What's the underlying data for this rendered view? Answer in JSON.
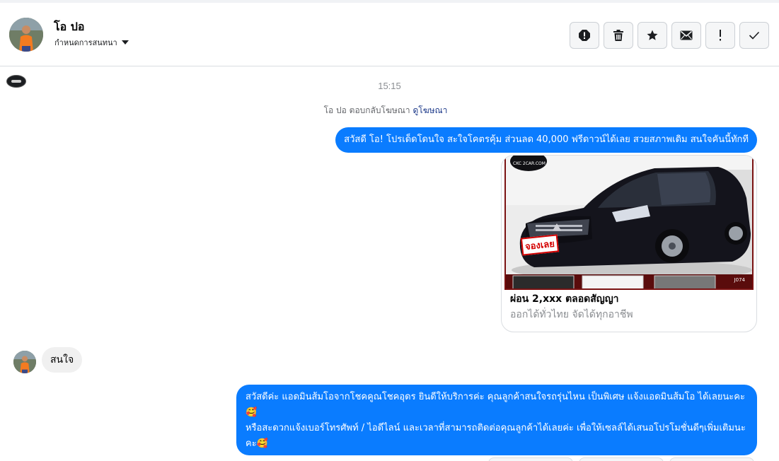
{
  "contact": {
    "name": "โอ ปอ",
    "assign_label": "กำหนดการสนทนา"
  },
  "toolbar": {
    "buttons": [
      {
        "icon": "report-icon"
      },
      {
        "icon": "trash-icon"
      },
      {
        "icon": "star-icon"
      },
      {
        "icon": "envelope-icon"
      },
      {
        "icon": "exclamation-icon"
      },
      {
        "icon": "checkmark-icon"
      }
    ]
  },
  "conversation": {
    "timestamp": "15:15",
    "reply_note": "โอ ปอ ตอบกลับโฆษณา",
    "reply_note_link": "ดูโฆษณา",
    "messages": [
      {
        "from": "page",
        "text": "สวัสดี โอ! โปรเด็ดโดนใจ สะใจโคตรคุ้ม ส่วนลด 40,000 ฟรีดาวน์ได้เลย สวยสภาพเดิม สนใจคันนี้ทักที"
      },
      {
        "from": "contact",
        "text": "สนใจ"
      },
      {
        "from": "page",
        "text": "สวัสดีค่ะ แอดมินส้มโอจากโชคคูณโชคอุดร ยินดีให้บริการค่ะ   คุณลูกค้าสนใจรถรุ่นไหน เป็นพิเศษ แจ้งแอดมินส้มโอ ได้เลยนะคะ🥰\nหรือสะดวกแจ้งเบอร์โทรศัพท์ / ไอดีไลน์ และเวลาที่สามารถติดต่อคุณลูกค้าได้เลยค่ะ เพื่อให้เซลล์ได้เสนอโปรโมชั่นดีๆเพิ่มเติมนะคะ🥰"
      }
    ],
    "ad_card": {
      "title": "ผ่อน 2,xxx ตลอดสัญญา",
      "description": "ออกได้ทั่วไทย จัดได้ทุกอาชีพ",
      "image_sticker": "จองเลย",
      "image_logo": "CKC 2CAR.COM",
      "image_code": "J074"
    }
  },
  "colors": {
    "outgoing_bubble": "#0a7cff",
    "incoming_bubble": "#f0f0f0",
    "link": "#1d3a8a"
  }
}
